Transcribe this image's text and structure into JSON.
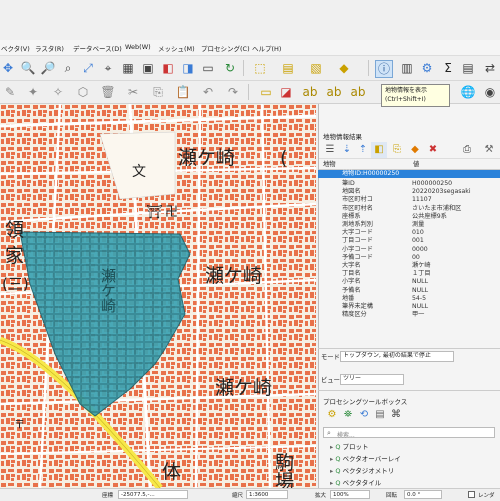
{
  "menu": [
    "ベクタ(V)",
    "ラスタ(R)",
    "データベース(D)",
    "Web(W)",
    "メッシュ(M)",
    "プロセシング(C)",
    "ヘルプ(H)"
  ],
  "tooltip": {
    "title": "地物情報を表示",
    "shortcut": "(Ctrl+Shift+I)"
  },
  "map": {
    "labels": {
      "seto1": "瀬ケ崎",
      "seto1_paren": "(",
      "seto2": "瀬ケ崎",
      "seto3": "瀬ケ崎",
      "ryo": "領",
      "ie": "家",
      "san": "(三)",
      "seto_vert": "瀬ケ崎",
      "koma": "駒",
      "ba": "場",
      "tai": "体"
    },
    "colors": {
      "building": "#e8714a",
      "road": "#ffffff",
      "bg": "#f6efe3",
      "selection": "#3ba3b3",
      "highway": "#f7e84a"
    }
  },
  "panel": {
    "title": "地物情報結果",
    "col_feature": "地物",
    "col_value": "値",
    "rows": [
      {
        "k": "",
        "v": "地物ID:H00000250",
        "sel": true
      },
      {
        "k": "筆ID",
        "v": "H000000250"
      },
      {
        "k": "地図名",
        "v": "20220203segasaki"
      },
      {
        "k": "市区町村コ",
        "v": "11107"
      },
      {
        "k": "市区町村名",
        "v": "さいたま市浦和区"
      },
      {
        "k": "座標系",
        "v": "公共座標9系"
      },
      {
        "k": "測地系判別",
        "v": "測量"
      },
      {
        "k": "大字コード",
        "v": "010"
      },
      {
        "k": "丁目コード",
        "v": "001"
      },
      {
        "k": "小字コード",
        "v": "0000"
      },
      {
        "k": "予備コード",
        "v": "00"
      },
      {
        "k": "大字名",
        "v": "瀬ケ崎"
      },
      {
        "k": "丁目名",
        "v": "１丁目"
      },
      {
        "k": "小字名",
        "v": "NULL"
      },
      {
        "k": "予備名",
        "v": "NULL"
      },
      {
        "k": "地番",
        "v": "54-5"
      },
      {
        "k": "筆界未定構",
        "v": "NULL"
      },
      {
        "k": "精度区分",
        "v": "甲一"
      }
    ],
    "mode_label": "モード",
    "mode_value": "トップダウン, 最初の結果で停止",
    "view_label": "ビュー",
    "view_value": "ツリー",
    "toolbox_title": "プロセシングツールボックス",
    "search_placeholder": "検索...",
    "tree": [
      "プロット",
      "ベクタオーバーレイ",
      "ベクタジオメトリ",
      "ベクタタイル"
    ]
  },
  "status": {
    "coord_label": "座標",
    "coord_value": "-25077.5,-...",
    "scale_label": "縮尺",
    "scale_value": "1:3600",
    "magnifier_label": "拡大",
    "magnifier_value": "100%",
    "rotation_label": "回転",
    "rotation_value": "0.0 °",
    "render_label": "レンダ",
    "extent_value": "-10398.0,-..."
  }
}
